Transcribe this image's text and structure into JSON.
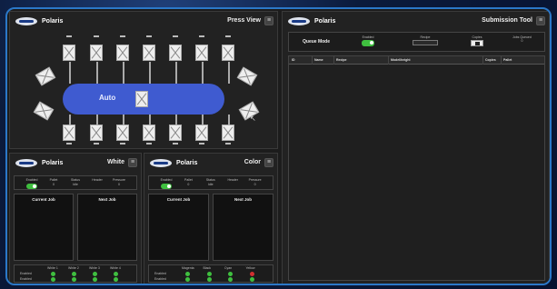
{
  "press_view": {
    "brand": "Polaris",
    "title": "Press View",
    "center_label": "Auto",
    "top_icons": [
      "",
      "",
      "",
      "",
      "",
      "",
      ""
    ],
    "bottom_icons": [
      "",
      "",
      "",
      "",
      "",
      "",
      ""
    ]
  },
  "white_panel": {
    "brand": "Polaris",
    "title": "White",
    "status": [
      {
        "label": "Enabled",
        "value": ""
      },
      {
        "label": "Pallet",
        "value": "0"
      },
      {
        "label": "Status",
        "value": "Idle"
      },
      {
        "label": "Header",
        "value": ""
      },
      {
        "label": "Pressure",
        "value": "0"
      }
    ],
    "current_job": "Current Job",
    "next_job": "Next Job",
    "columns": [
      "White 1",
      "White 2",
      "White 3",
      "White 4"
    ],
    "rows": [
      {
        "label": "Enabled",
        "colors": [
          "#3fbf3f",
          "#3fbf3f",
          "#3fbf3f",
          "#3fbf3f"
        ]
      },
      {
        "label": "Enabled",
        "colors": [
          "#3fbf3f",
          "#3fbf3f",
          "#3fbf3f",
          "#3fbf3f"
        ]
      }
    ]
  },
  "color_panel": {
    "brand": "Polaris",
    "title": "Color",
    "status": [
      {
        "label": "Enabled",
        "value": ""
      },
      {
        "label": "Pallet",
        "value": "0"
      },
      {
        "label": "Status",
        "value": "Idle"
      },
      {
        "label": "Header",
        "value": ""
      },
      {
        "label": "Pressure",
        "value": "0"
      }
    ],
    "current_job": "Current Job",
    "next_job": "Next Job",
    "columns": [
      "Magenta",
      "Black",
      "Cyan",
      "Yellow"
    ],
    "rows": [
      {
        "label": "Enabled",
        "colors": [
          "#3fbf3f",
          "#3fbf3f",
          "#3fbf3f",
          "#d03030"
        ]
      },
      {
        "label": "Enabled",
        "colors": [
          "#3fbf3f",
          "#3fbf3f",
          "#3fbf3f",
          "#3fbf3f"
        ]
      }
    ]
  },
  "submission": {
    "brand": "Polaris",
    "title": "Submission Tool",
    "queue_mode": "Queue Mode",
    "enabled_label": "Enabled",
    "recipe_label": "Recipe",
    "recipe_value": "",
    "copies_label": "Copies",
    "jobs_label": "Jobs Queued",
    "jobs_value": "0",
    "columns": [
      "ID",
      "Name",
      "Recipe",
      "Model/height",
      "Copies",
      "Pallet"
    ]
  }
}
